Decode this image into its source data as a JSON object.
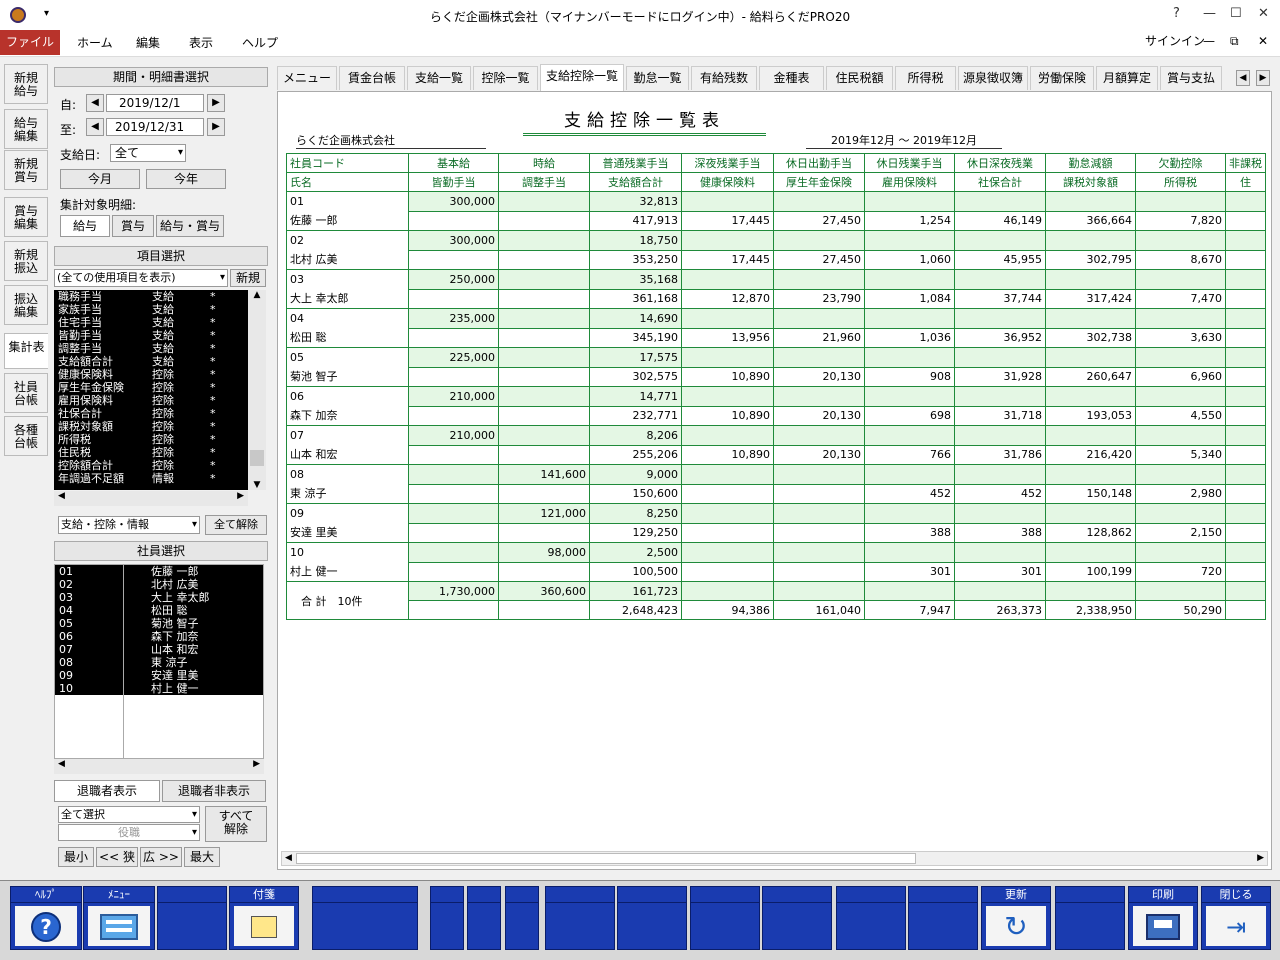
{
  "window": {
    "title": "らくだ企画株式会社（マイナンバーモードにログイン中）- 給料らくだPRO20",
    "signin": "サインイン"
  },
  "ribbon": {
    "file": "ファイル",
    "tabs": [
      "ホーム",
      "編集",
      "表示",
      "ヘルプ"
    ]
  },
  "vtabs": [
    "新規\n給与",
    "給与\n編集",
    "新規\n賞与",
    "賞与\n編集",
    "新規\n振込",
    "振込\n編集",
    "集計表",
    "社員\n台帳",
    "各種\n台帳"
  ],
  "panel": {
    "period_header": "期間・明細書選択",
    "from_label": "自:",
    "from_value": "2019/12/1",
    "to_label": "至:",
    "to_value": "2019/12/31",
    "payday_label": "支給日:",
    "payday_value": "全て",
    "btn_month": "今月",
    "btn_year": "今年",
    "target_label": "集計対象明細:",
    "target_btns": [
      "給与",
      "賞与",
      "給与・賞与"
    ],
    "item_header": "項目選択",
    "item_filter": "(全ての使用項目を表示)",
    "btn_new": "新規",
    "items": [
      [
        "職務手当",
        "支給",
        "*"
      ],
      [
        "家族手当",
        "支給",
        "*"
      ],
      [
        "住宅手当",
        "支給",
        "*"
      ],
      [
        "皆勤手当",
        "支給",
        "*"
      ],
      [
        "調整手当",
        "支給",
        "*"
      ],
      [
        "支給額合計",
        "支給",
        "*"
      ],
      [
        "健康保険料",
        "控除",
        "*"
      ],
      [
        "厚生年金保険",
        "控除",
        "*"
      ],
      [
        "雇用保険料",
        "控除",
        "*"
      ],
      [
        "社保合計",
        "控除",
        "*"
      ],
      [
        "課税対象額",
        "控除",
        "*"
      ],
      [
        "所得税",
        "控除",
        "*"
      ],
      [
        "住民税",
        "控除",
        "*"
      ],
      [
        "控除額合計",
        "控除",
        "*"
      ],
      [
        "年調過不足額",
        "情報",
        "*"
      ]
    ],
    "item_type_filter": "支給・控除・情報",
    "btn_clear_all": "全て解除",
    "emp_header": "社員選択",
    "employees": [
      [
        "01",
        "佐藤 一郎"
      ],
      [
        "02",
        "北村 広美"
      ],
      [
        "03",
        "大上 幸太郎"
      ],
      [
        "04",
        "松田 聡"
      ],
      [
        "05",
        "菊池 智子"
      ],
      [
        "06",
        "森下 加奈"
      ],
      [
        "07",
        "山本 和宏"
      ],
      [
        "08",
        "東 涼子"
      ],
      [
        "09",
        "安達 里美"
      ],
      [
        "10",
        "村上 健一"
      ]
    ],
    "btn_show_retired": "退職者表示",
    "btn_hide_retired": "退職者非表示",
    "select_all": "全て選択",
    "position": "役職",
    "btn_release_all": "すべて\n解除",
    "zoom_btns": [
      "最小",
      "<< 狭",
      "広 >>",
      "最大"
    ]
  },
  "tabs": [
    "メニュー",
    "賃金台帳",
    "支給一覧",
    "控除一覧",
    "支給控除一覧",
    "勤怠一覧",
    "有給残数",
    "金種表",
    "住民税額",
    "所得税",
    "源泉徴収簿",
    "労働保険",
    "月額算定",
    "賞与支払"
  ],
  "report": {
    "title": "支給控除一覧表",
    "company": "らくだ企画株式会社",
    "period": "2019年12月 ～ 2019年12月",
    "head_code": "社員コード",
    "head_name": "氏名",
    "head_top": [
      "基本給",
      "時給",
      "普通残業手当",
      "深夜残業手当",
      "休日出勤手当",
      "休日残業手当",
      "休日深夜残業",
      "勤怠減額",
      "欠勤控除",
      "非課税"
    ],
    "head_bottom": [
      "皆勤手当",
      "調整手当",
      "支給額合計",
      "健康保険料",
      "厚生年金保険",
      "雇用保険料",
      "社保合計",
      "課税対象額",
      "所得税",
      "住"
    ],
    "rows": [
      {
        "code": "01",
        "name": "佐藤 一郎",
        "top": [
          "300,000",
          "",
          "32,813",
          "",
          "",
          "",
          "",
          "",
          "",
          ""
        ],
        "bottom": [
          "",
          "",
          "417,913",
          "17,445",
          "27,450",
          "1,254",
          "46,149",
          "366,664",
          "7,820",
          ""
        ]
      },
      {
        "code": "02",
        "name": "北村 広美",
        "top": [
          "300,000",
          "",
          "18,750",
          "",
          "",
          "",
          "",
          "",
          "",
          ""
        ],
        "bottom": [
          "",
          "",
          "353,250",
          "17,445",
          "27,450",
          "1,060",
          "45,955",
          "302,795",
          "8,670",
          ""
        ]
      },
      {
        "code": "03",
        "name": "大上 幸太郎",
        "top": [
          "250,000",
          "",
          "35,168",
          "",
          "",
          "",
          "",
          "",
          "",
          ""
        ],
        "bottom": [
          "",
          "",
          "361,168",
          "12,870",
          "23,790",
          "1,084",
          "37,744",
          "317,424",
          "7,470",
          ""
        ]
      },
      {
        "code": "04",
        "name": "松田 聡",
        "top": [
          "235,000",
          "",
          "14,690",
          "",
          "",
          "",
          "",
          "",
          "",
          ""
        ],
        "bottom": [
          "",
          "",
          "345,190",
          "13,956",
          "21,960",
          "1,036",
          "36,952",
          "302,738",
          "3,630",
          ""
        ]
      },
      {
        "code": "05",
        "name": "菊池 智子",
        "top": [
          "225,000",
          "",
          "17,575",
          "",
          "",
          "",
          "",
          "",
          "",
          ""
        ],
        "bottom": [
          "",
          "",
          "302,575",
          "10,890",
          "20,130",
          "908",
          "31,928",
          "260,647",
          "6,960",
          ""
        ]
      },
      {
        "code": "06",
        "name": "森下 加奈",
        "top": [
          "210,000",
          "",
          "14,771",
          "",
          "",
          "",
          "",
          "",
          "",
          ""
        ],
        "bottom": [
          "",
          "",
          "232,771",
          "10,890",
          "20,130",
          "698",
          "31,718",
          "193,053",
          "4,550",
          ""
        ]
      },
      {
        "code": "07",
        "name": "山本 和宏",
        "top": [
          "210,000",
          "",
          "8,206",
          "",
          "",
          "",
          "",
          "",
          "",
          ""
        ],
        "bottom": [
          "",
          "",
          "255,206",
          "10,890",
          "20,130",
          "766",
          "31,786",
          "216,420",
          "5,340",
          ""
        ]
      },
      {
        "code": "08",
        "name": "東 涼子",
        "top": [
          "",
          "141,600",
          "9,000",
          "",
          "",
          "",
          "",
          "",
          "",
          ""
        ],
        "bottom": [
          "",
          "",
          "150,600",
          "",
          "",
          "452",
          "452",
          "150,148",
          "2,980",
          ""
        ]
      },
      {
        "code": "09",
        "name": "安達 里美",
        "top": [
          "",
          "121,000",
          "8,250",
          "",
          "",
          "",
          "",
          "",
          "",
          ""
        ],
        "bottom": [
          "",
          "",
          "129,250",
          "",
          "",
          "388",
          "388",
          "128,862",
          "2,150",
          ""
        ]
      },
      {
        "code": "10",
        "name": "村上 健一",
        "top": [
          "",
          "98,000",
          "2,500",
          "",
          "",
          "",
          "",
          "",
          "",
          ""
        ],
        "bottom": [
          "",
          "",
          "100,500",
          "",
          "",
          "301",
          "301",
          "100,199",
          "720",
          ""
        ]
      }
    ],
    "total_label": "合 計　10件",
    "total_top": [
      "1,730,000",
      "360,600",
      "161,723",
      "",
      "",
      "",
      "",
      "",
      "",
      ""
    ],
    "total_bottom": [
      "",
      "",
      "2,648,423",
      "94,386",
      "161,040",
      "7,947",
      "263,373",
      "2,338,950",
      "50,290",
      ""
    ]
  },
  "fkeys": [
    {
      "label": "ﾍﾙﾌﾟ",
      "icon": "help-icon"
    },
    {
      "label": "ﾒﾆｭｰ",
      "icon": "menu-icon"
    },
    {
      "label": "",
      "icon": ""
    },
    {
      "label": "付箋",
      "icon": "sticky-note-icon"
    },
    {
      "label": "",
      "icon": ""
    },
    {
      "label": "",
      "icon": ""
    },
    {
      "label": "",
      "icon": ""
    },
    {
      "label": "",
      "icon": ""
    },
    {
      "label": "",
      "icon": ""
    },
    {
      "label": "",
      "icon": ""
    },
    {
      "label": "",
      "icon": ""
    },
    {
      "label": "",
      "icon": ""
    },
    {
      "label": "",
      "icon": ""
    },
    {
      "label": "更新",
      "icon": "refresh-icon"
    },
    {
      "label": "",
      "icon": ""
    },
    {
      "label": "印刷",
      "icon": "printer-icon"
    },
    {
      "label": "閉じる",
      "icon": "exit-icon"
    }
  ]
}
